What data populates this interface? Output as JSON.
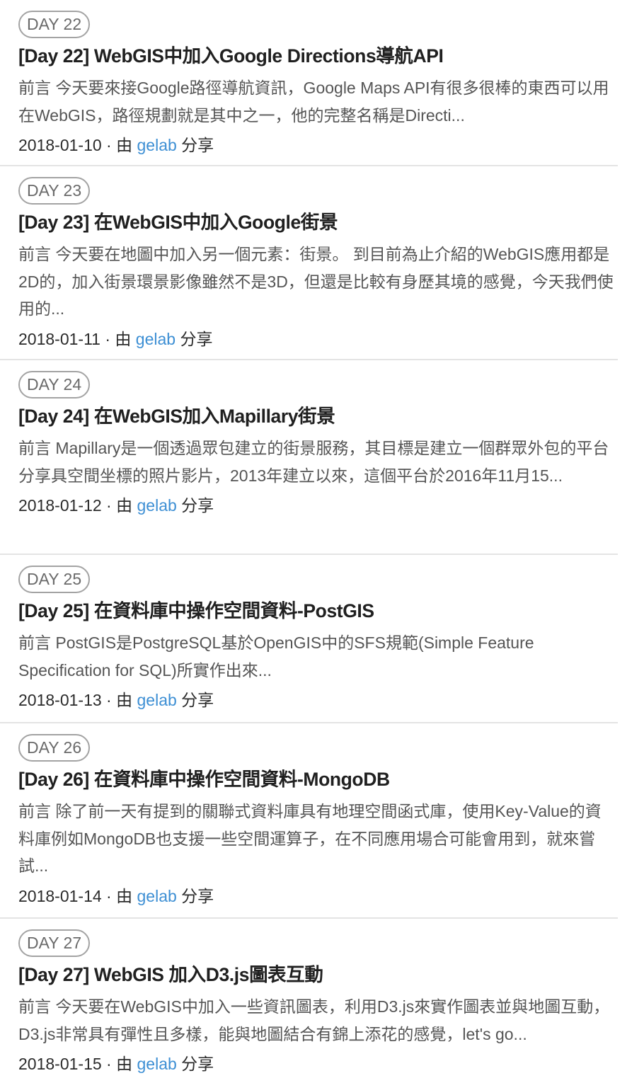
{
  "articles": [
    {
      "badge": "DAY 22",
      "title": "[Day 22] WebGIS中加入Google Directions導航API",
      "excerpt": "前言 今天要來接Google路徑導航資訊，Google Maps API有很多很棒的東西可以用在WebGIS，路徑規劃就是其中之一，他的完整名稱是Directi...",
      "date": "2018-01-10",
      "sep": " · 由 ",
      "author": "gelab",
      "action": " 分享"
    },
    {
      "badge": "DAY 23",
      "title": "[Day 23] 在WebGIS中加入Google街景",
      "excerpt": "前言 今天要在地圖中加入另一個元素：街景。 到目前為止介紹的WebGIS應用都是2D的，加入街景環景影像雖然不是3D，但還是比較有身歷其境的感覺，今天我們使用的...",
      "date": "2018-01-11",
      "sep": " · 由 ",
      "author": "gelab",
      "action": " 分享"
    },
    {
      "badge": "DAY 24",
      "title": "[Day 24] 在WebGIS加入Mapillary街景",
      "excerpt": "前言 Mapillary是一個透過眾包建立的街景服務，其目標是建立一個群眾外包的平台分享具空間坐標的照片影片，2013年建立以來，這個平台於2016年11月15...",
      "date": "2018-01-12",
      "sep": " · 由 ",
      "author": "gelab",
      "action": " 分享"
    },
    {
      "badge": "DAY 25",
      "title": "[Day 25] 在資料庫中操作空間資料-PostGIS",
      "excerpt": "前言 PostGIS是PostgreSQL基於OpenGIS中的SFS規範(Simple Feature Specification for SQL)所實作出來...",
      "date": "2018-01-13",
      "sep": " · 由 ",
      "author": "gelab",
      "action": " 分享"
    },
    {
      "badge": "DAY 26",
      "title": "[Day 26] 在資料庫中操作空間資料-MongoDB",
      "excerpt": "前言 除了前一天有提到的關聯式資料庫具有地理空間函式庫，使用Key-Value的資料庫例如MongoDB也支援一些空間運算子，在不同應用場合可能會用到，就來嘗試...",
      "date": "2018-01-14",
      "sep": " · 由 ",
      "author": "gelab",
      "action": " 分享"
    },
    {
      "badge": "DAY 27",
      "title": "[Day 27] WebGIS 加入D3.js圖表互動",
      "excerpt": "前言 今天要在WebGIS中加入一些資訊圖表，利用D3.js來實作圖表並與地圖互動，D3.js非常具有彈性且多樣，能與地圖結合有錦上添花的感覺，let's go...",
      "date": "2018-01-15",
      "sep": " · 由 ",
      "author": "gelab",
      "action": " 分享"
    }
  ],
  "colors": {
    "author_link": "#3d8fd4",
    "badge_border": "#a3a3a3",
    "divider": "#e4e4e4"
  }
}
